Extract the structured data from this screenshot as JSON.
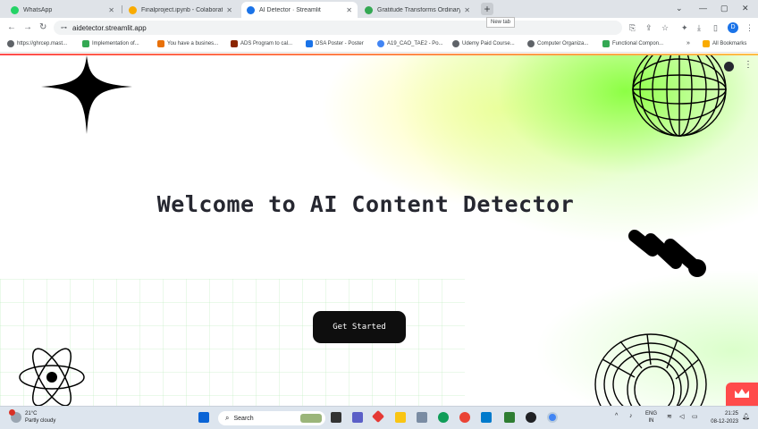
{
  "browser": {
    "tabs": [
      {
        "label": "WhatsApp",
        "color": "#25d366"
      },
      {
        "label": "Finalproject.ipynb - Colaboratory",
        "color": "#f9ab00"
      },
      {
        "label": "AI Detector · Streamlit",
        "color": "#1a73e8"
      },
      {
        "label": "Gratitude Transforms Ordinary Days",
        "color": "#34a853"
      }
    ],
    "newtab_tooltip": "New tab",
    "url": "aidetector.streamlit.app",
    "profile_initial": "D"
  },
  "bookmarks": [
    "https://ghrcep.mast...",
    "Implementation of...",
    "You have a busines...",
    "ADS Program to cal...",
    "DSA Poster - Poster",
    "A19_CAO_TAE2 - Po...",
    "Udemy Paid Course...",
    "Computer Organiza...",
    "Functional Compon..."
  ],
  "all_bookmarks_label": "All Bookmarks",
  "page": {
    "title": "Welcome to AI Content Detector",
    "cta_label": "Get Started",
    "accent": "#ff4b4b"
  },
  "taskbar": {
    "temperature": "21°C",
    "weather": "Partly cloudy",
    "search_label": "Search",
    "lang": "ENG",
    "region": "IN",
    "time": "21:25",
    "date": "08-12-2023"
  }
}
